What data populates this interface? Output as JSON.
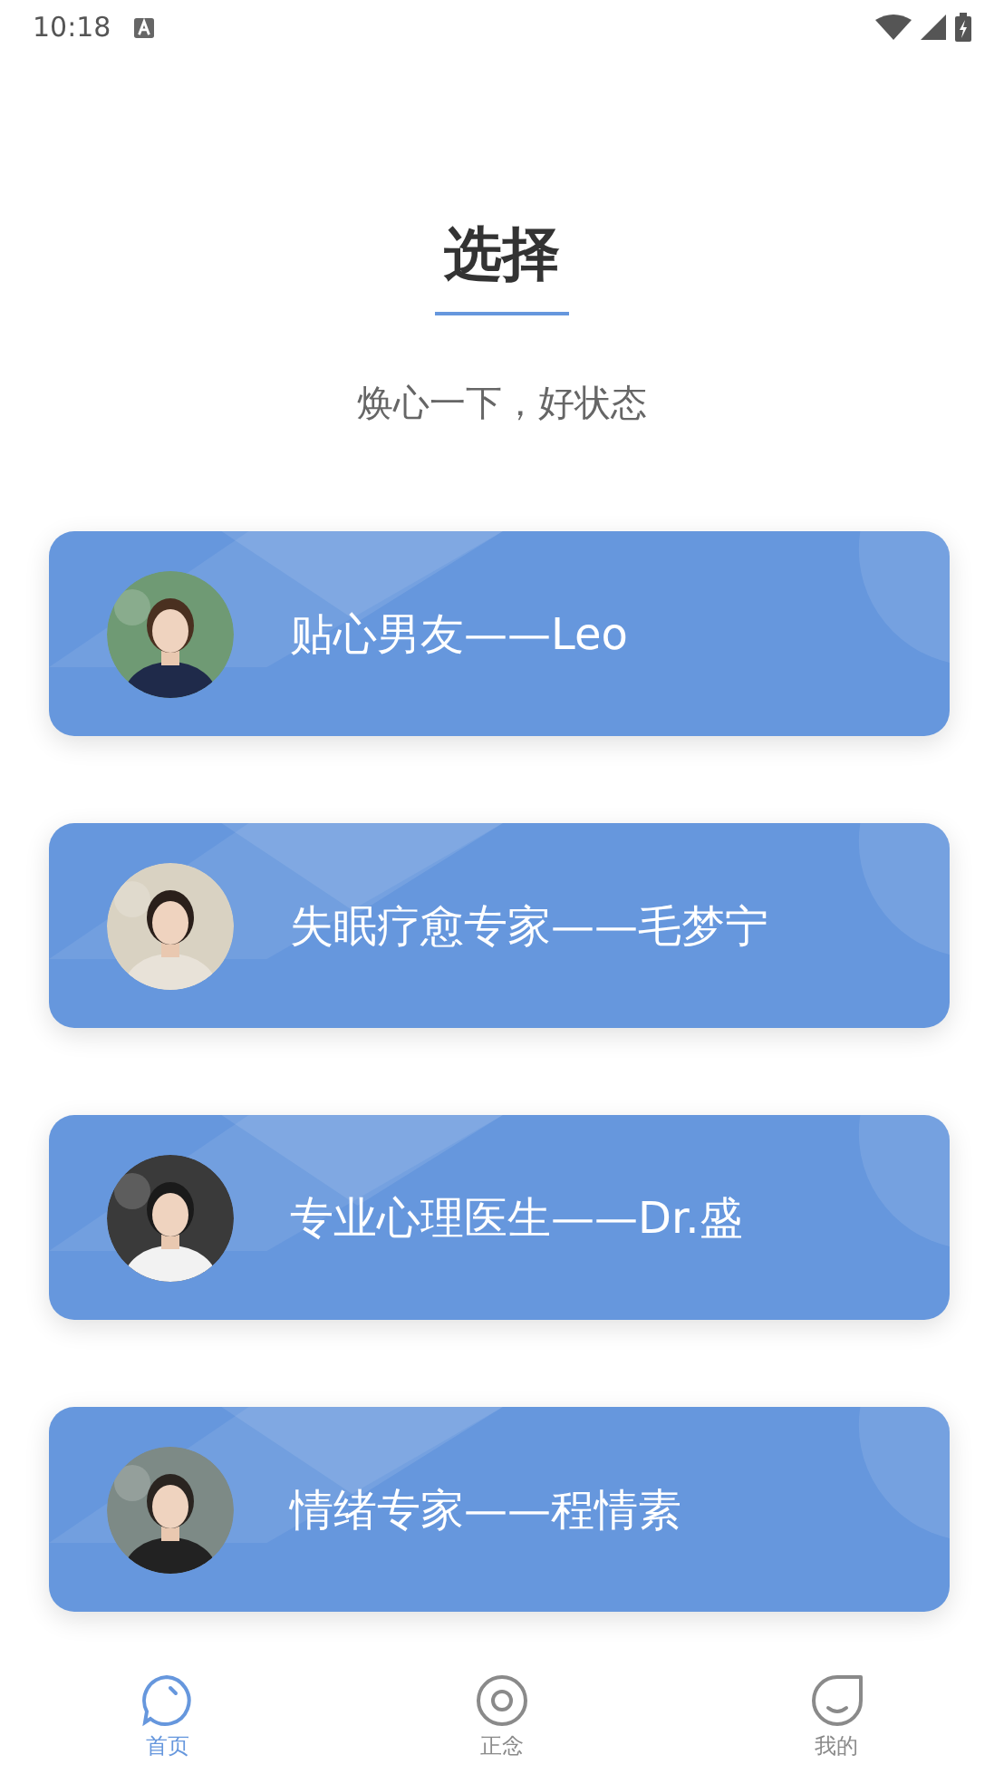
{
  "status_bar": {
    "time": "10:18"
  },
  "header": {
    "title": "选择",
    "subtitle": "焕心一下，好状态"
  },
  "cards": [
    {
      "name": "贴心男友——Leo"
    },
    {
      "name": "失眠疗愈专家——毛梦宁"
    },
    {
      "name": "专业心理医生——Dr.盛"
    },
    {
      "name": "情绪专家——程情素"
    }
  ],
  "nav": [
    {
      "label": "首页",
      "kind": "chat",
      "selected": true
    },
    {
      "label": "正念",
      "kind": "target",
      "selected": false
    },
    {
      "label": "我的",
      "kind": "smile",
      "selected": false
    }
  ]
}
